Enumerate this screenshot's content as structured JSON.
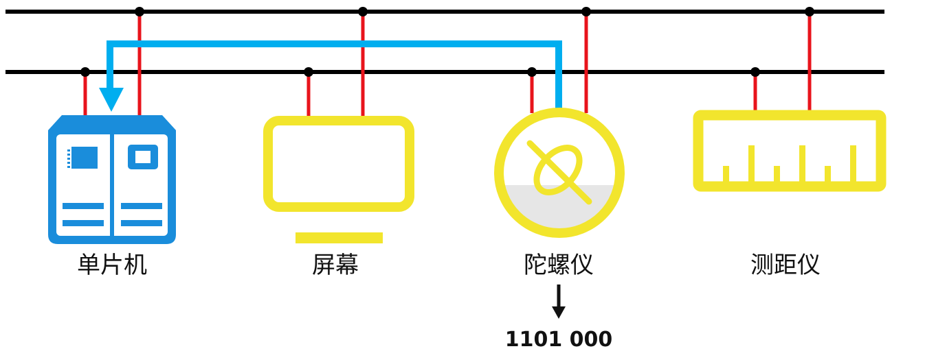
{
  "colors": {
    "bus": "#000000",
    "connection": "#e8141c",
    "data_path": "#00aeef",
    "mcu": "#1a8ddb",
    "peripheral": "#f2e52d",
    "gyro_fill": "#e6e6e6"
  },
  "devices": {
    "mcu": {
      "label": "单片机",
      "icon": "microcontroller-icon"
    },
    "screen": {
      "label": "屏幕",
      "icon": "monitor-icon"
    },
    "gyroscope": {
      "label": "陀螺仪",
      "icon": "gyroscope-icon"
    },
    "rangefinder": {
      "label": "测距仪",
      "icon": "ruler-icon"
    }
  },
  "gyro_output": {
    "value": "1101 000",
    "icon": "arrow-down-icon"
  }
}
